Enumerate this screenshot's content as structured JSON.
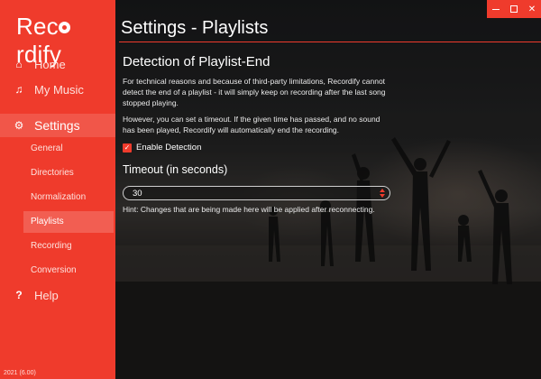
{
  "app": {
    "logo_pre": "Rec",
    "logo_post": "rdify",
    "version": "2021 (6.00)",
    "accent_color": "#ef3b2c"
  },
  "sidebar": {
    "items": [
      {
        "label": "Home",
        "icon": "home-icon",
        "glyph": "⌂"
      },
      {
        "label": "My Music",
        "icon": "music-note-icon",
        "glyph": "♫"
      },
      {
        "label": "Settings",
        "icon": "gear-icon",
        "glyph": "⚙"
      },
      {
        "label": "Help",
        "icon": "question-icon",
        "glyph": "?"
      }
    ],
    "sub_items": [
      "General",
      "Directories",
      "Normalization",
      "Playlists",
      "Recording",
      "Conversion"
    ]
  },
  "window_controls": {
    "close": "✕"
  },
  "main": {
    "title": "Settings - Playlists",
    "section_title": "Detection of Playlist-End",
    "paragraph1": "For technical reasons and because of third-party limitations, Recordify cannot detect the end of a playlist - it will simply keep on recording after the last song stopped playing.",
    "paragraph2": "However, you can set a timeout. If the given time has passed, and no sound has been played, Recordify will automatically end the recording.",
    "checkbox_label": "Enable Detection",
    "checkbox_checked": true,
    "checkbox_glyph": "✓",
    "timeout_label": "Timeout (in seconds)",
    "timeout_value": "30",
    "hint": "Hint: Changes that are being made here will be applied after reconnecting."
  }
}
